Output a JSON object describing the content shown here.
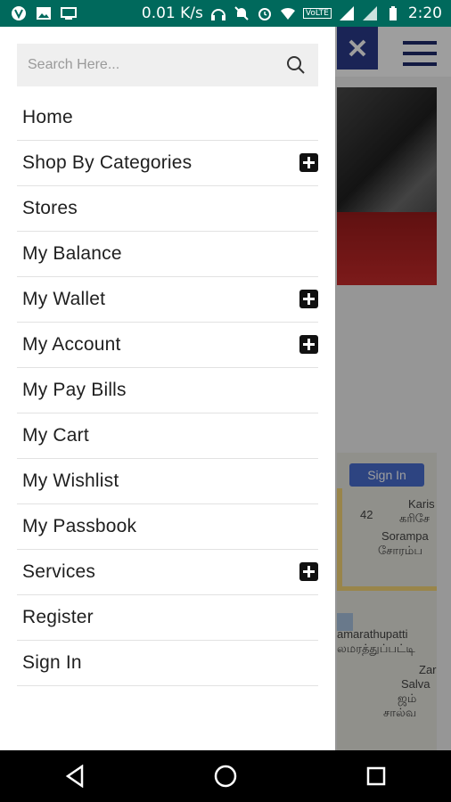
{
  "status_bar": {
    "speed": "0.01 K/s",
    "time": "2:20",
    "network_badge": "VoLTE"
  },
  "search": {
    "placeholder": "Search Here..."
  },
  "menu": {
    "items": [
      {
        "label": "Home",
        "expandable": false
      },
      {
        "label": "Shop By Categories",
        "expandable": true
      },
      {
        "label": "Stores",
        "expandable": false
      },
      {
        "label": "My Balance",
        "expandable": false
      },
      {
        "label": "My Wallet",
        "expandable": true
      },
      {
        "label": "My Account",
        "expandable": true
      },
      {
        "label": "My Pay Bills",
        "expandable": false
      },
      {
        "label": "My Cart",
        "expandable": false
      },
      {
        "label": "My Wishlist",
        "expandable": false
      },
      {
        "label": "My Passbook",
        "expandable": false
      },
      {
        "label": "Services",
        "expandable": true
      },
      {
        "label": "Register",
        "expandable": false
      },
      {
        "label": "Sign In",
        "expandable": false
      }
    ]
  },
  "background": {
    "map_signin": "Sign In",
    "map_labels": [
      "Karis",
      "கரிசே",
      "Sorampa",
      "சோரம்ப",
      "amarathupatti",
      "லமரத்துப்பட்டி",
      "Zar",
      "Salva",
      "ஜம்",
      "சால்வ",
      "42"
    ]
  },
  "colors": {
    "status_bar": "#00695c",
    "header_close_bg": "#2b3a8c",
    "plus_icon": "#111111"
  }
}
